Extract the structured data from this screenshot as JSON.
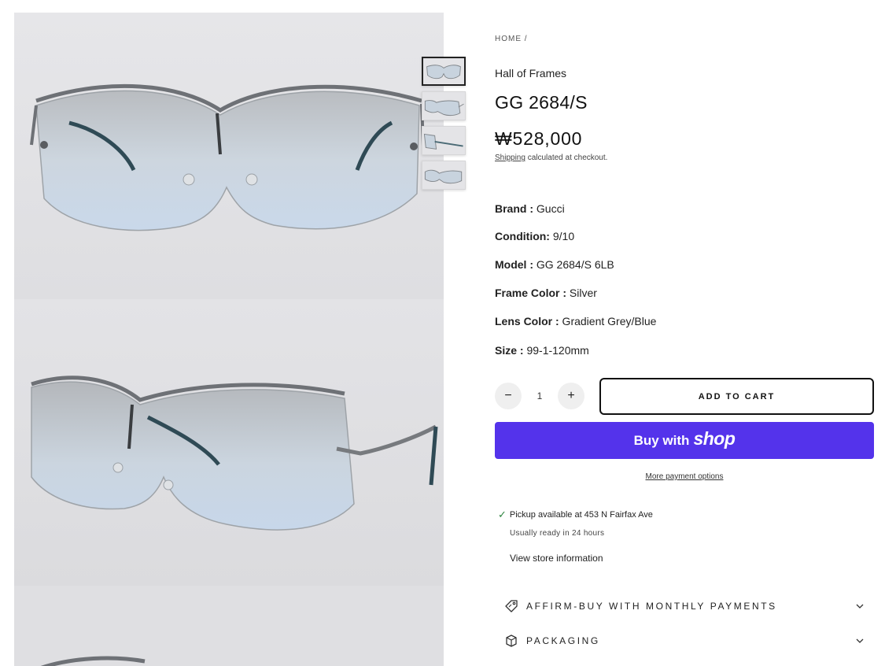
{
  "breadcrumb": "HOME /",
  "vendor": "Hall of Frames",
  "product": {
    "title": "GG 2684/S",
    "price": "₩528,000",
    "shipping_link": "Shipping",
    "shipping_rest": " calculated at checkout."
  },
  "specs": [
    {
      "label": "Brand :",
      "value": " Gucci"
    },
    {
      "label": "Condition:",
      "value": " 9/10"
    },
    {
      "label": "Model :",
      "value": " GG 2684/S 6LB"
    },
    {
      "label": "Frame Color :",
      "value": " Silver"
    },
    {
      "label": "Lens Color :",
      "value": " Gradient Grey/Blue"
    },
    {
      "label": "Size :",
      "value": " 99-1-120mm"
    }
  ],
  "quantity": {
    "minus": "−",
    "value": "1",
    "plus": "+"
  },
  "add_to_cart": "ADD TO CART",
  "buy_with": "Buy with",
  "shop_logo": "shop",
  "more_payment": "More payment options",
  "pickup": {
    "line": "Pickup available at 453 N Fairfax Ave",
    "ready": "Usually ready in 24 hours",
    "view_store": "View store information"
  },
  "accordions": [
    {
      "label": "AFFIRM-BUY WITH MONTHLY PAYMENTS",
      "icon": "tag-icon"
    },
    {
      "label": "PACKAGING",
      "icon": "box-icon"
    }
  ],
  "colors": {
    "shop_pay": "#5433eb",
    "check": "#2e8540"
  }
}
